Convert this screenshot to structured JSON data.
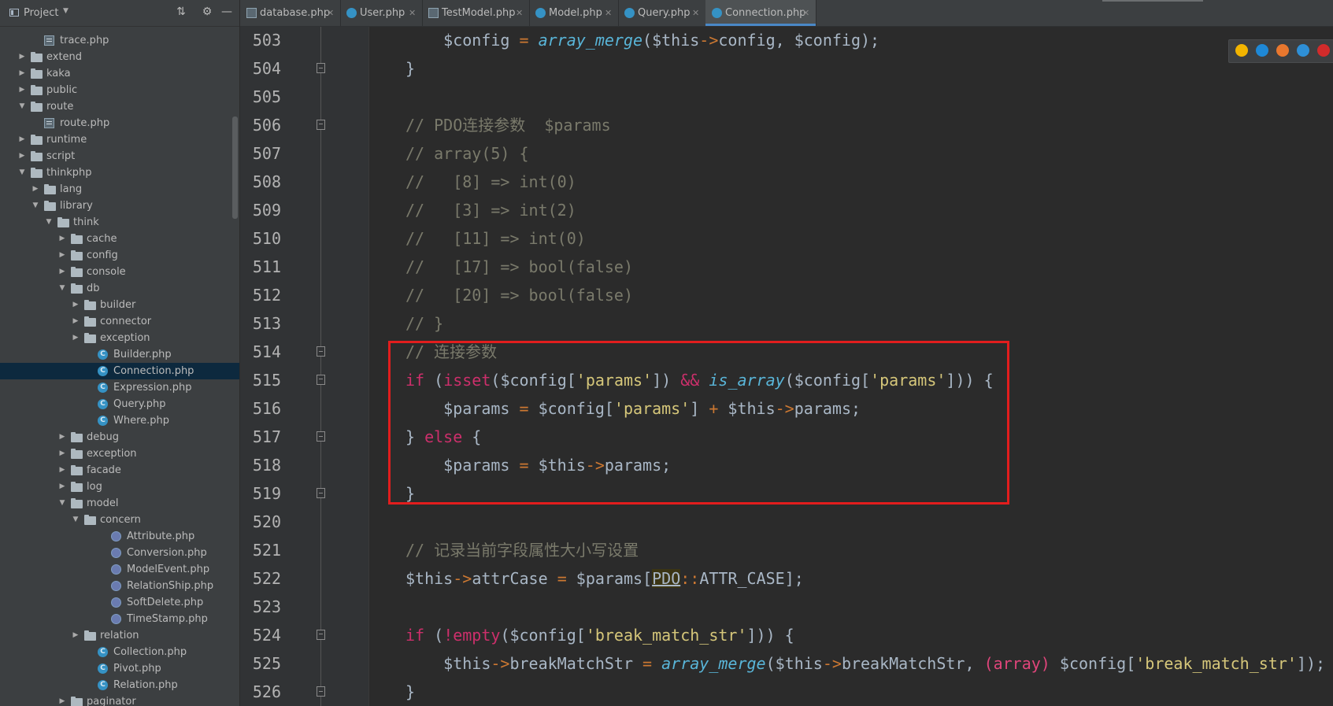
{
  "sidebar": {
    "title": "Project",
    "items": [
      {
        "label": "trace.php",
        "kind": "php",
        "depth": 2,
        "arrow": ""
      },
      {
        "label": "extend",
        "kind": "folder",
        "depth": 1,
        "arrow": "▶"
      },
      {
        "label": "kaka",
        "kind": "folder",
        "depth": 1,
        "arrow": "▶"
      },
      {
        "label": "public",
        "kind": "folder",
        "depth": 1,
        "arrow": "▶"
      },
      {
        "label": "route",
        "kind": "folder",
        "depth": 1,
        "arrow": "▼"
      },
      {
        "label": "route.php",
        "kind": "php",
        "depth": 2,
        "arrow": ""
      },
      {
        "label": "runtime",
        "kind": "folder",
        "depth": 1,
        "arrow": "▶"
      },
      {
        "label": "script",
        "kind": "folder",
        "depth": 1,
        "arrow": "▶"
      },
      {
        "label": "thinkphp",
        "kind": "folder",
        "depth": 1,
        "arrow": "▼"
      },
      {
        "label": "lang",
        "kind": "folder",
        "depth": 2,
        "arrow": "▶"
      },
      {
        "label": "library",
        "kind": "folder",
        "depth": 2,
        "arrow": "▼"
      },
      {
        "label": "think",
        "kind": "folder",
        "depth": 3,
        "arrow": "▼"
      },
      {
        "label": "cache",
        "kind": "folder",
        "depth": 4,
        "arrow": "▶"
      },
      {
        "label": "config",
        "kind": "folder",
        "depth": 4,
        "arrow": "▶"
      },
      {
        "label": "console",
        "kind": "folder",
        "depth": 4,
        "arrow": "▶"
      },
      {
        "label": "db",
        "kind": "folder",
        "depth": 4,
        "arrow": "▼"
      },
      {
        "label": "builder",
        "kind": "folder",
        "depth": 5,
        "arrow": "▶"
      },
      {
        "label": "connector",
        "kind": "folder",
        "depth": 5,
        "arrow": "▶"
      },
      {
        "label": "exception",
        "kind": "folder",
        "depth": 5,
        "arrow": "▶"
      },
      {
        "label": "Builder.php",
        "kind": "abstract",
        "depth": 6,
        "arrow": ""
      },
      {
        "label": "Connection.php",
        "kind": "abstract",
        "depth": 6,
        "arrow": "",
        "selected": true
      },
      {
        "label": "Expression.php",
        "kind": "class",
        "depth": 6,
        "arrow": ""
      },
      {
        "label": "Query.php",
        "kind": "class",
        "depth": 6,
        "arrow": ""
      },
      {
        "label": "Where.php",
        "kind": "class",
        "depth": 6,
        "arrow": ""
      },
      {
        "label": "debug",
        "kind": "folder",
        "depth": 4,
        "arrow": "▶"
      },
      {
        "label": "exception",
        "kind": "folder",
        "depth": 4,
        "arrow": "▶"
      },
      {
        "label": "facade",
        "kind": "folder",
        "depth": 4,
        "arrow": "▶"
      },
      {
        "label": "log",
        "kind": "folder",
        "depth": 4,
        "arrow": "▶"
      },
      {
        "label": "model",
        "kind": "folder",
        "depth": 4,
        "arrow": "▼"
      },
      {
        "label": "concern",
        "kind": "folder",
        "depth": 5,
        "arrow": "▼"
      },
      {
        "label": "Attribute.php",
        "kind": "trait",
        "depth": 7,
        "arrow": ""
      },
      {
        "label": "Conversion.php",
        "kind": "trait",
        "depth": 7,
        "arrow": ""
      },
      {
        "label": "ModelEvent.php",
        "kind": "trait",
        "depth": 7,
        "arrow": ""
      },
      {
        "label": "RelationShip.php",
        "kind": "trait",
        "depth": 7,
        "arrow": ""
      },
      {
        "label": "SoftDelete.php",
        "kind": "trait",
        "depth": 7,
        "arrow": ""
      },
      {
        "label": "TimeStamp.php",
        "kind": "trait",
        "depth": 7,
        "arrow": ""
      },
      {
        "label": "relation",
        "kind": "folder",
        "depth": 5,
        "arrow": "▶"
      },
      {
        "label": "Collection.php",
        "kind": "class",
        "depth": 6,
        "arrow": ""
      },
      {
        "label": "Pivot.php",
        "kind": "class",
        "depth": 6,
        "arrow": ""
      },
      {
        "label": "Relation.php",
        "kind": "abstract",
        "depth": 6,
        "arrow": ""
      },
      {
        "label": "paginator",
        "kind": "folder",
        "depth": 4,
        "arrow": "▶"
      }
    ]
  },
  "tabs": [
    {
      "label": "database.php",
      "icon": "php-file-icon",
      "active": false
    },
    {
      "label": "User.php",
      "icon": "class-icon",
      "active": false
    },
    {
      "label": "TestModel.php",
      "icon": "php-file-icon",
      "active": false
    },
    {
      "label": "Model.php",
      "icon": "abstract-class-icon",
      "active": false
    },
    {
      "label": "Query.php",
      "icon": "class-icon",
      "active": false
    },
    {
      "label": "Connection.php",
      "icon": "abstract-class-icon",
      "active": true
    }
  ],
  "editor": {
    "lines": [
      {
        "no": "503",
        "fold": "",
        "tokens": [
          [
            "    ",
            "plain"
          ],
          [
            "$config",
            "var"
          ],
          [
            " = ",
            "op"
          ],
          [
            "array_merge",
            "fn"
          ],
          [
            "($this",
            "var"
          ],
          [
            "->",
            "arrow"
          ],
          [
            "config, $config);",
            "plain"
          ]
        ]
      },
      {
        "no": "504",
        "fold": "close",
        "tokens": [
          [
            "}",
            "plain"
          ]
        ]
      },
      {
        "no": "505",
        "fold": "",
        "tokens": []
      },
      {
        "no": "506",
        "fold": "open",
        "tokens": [
          [
            "// PDO连接参数  $params",
            "cmt"
          ]
        ]
      },
      {
        "no": "507",
        "fold": "",
        "tokens": [
          [
            "// array(5) {",
            "cmt"
          ]
        ]
      },
      {
        "no": "508",
        "fold": "",
        "tokens": [
          [
            "//   [8] => int(0)",
            "cmt"
          ]
        ]
      },
      {
        "no": "509",
        "fold": "",
        "tokens": [
          [
            "//   [3] => int(2)",
            "cmt"
          ]
        ]
      },
      {
        "no": "510",
        "fold": "",
        "tokens": [
          [
            "//   [11] => int(0)",
            "cmt"
          ]
        ]
      },
      {
        "no": "511",
        "fold": "",
        "tokens": [
          [
            "//   [17] => bool(false)",
            "cmt"
          ]
        ]
      },
      {
        "no": "512",
        "fold": "",
        "tokens": [
          [
            "//   [20] => bool(false)",
            "cmt"
          ]
        ]
      },
      {
        "no": "513",
        "fold": "",
        "tokens": [
          [
            "// }",
            "cmt"
          ]
        ]
      },
      {
        "no": "514",
        "fold": "close",
        "tokens": [
          [
            "// 连接参数",
            "cmt"
          ]
        ]
      },
      {
        "no": "515",
        "fold": "open",
        "tokens": [
          [
            "if",
            "kw"
          ],
          [
            " (",
            "plain"
          ],
          [
            "isset",
            "kw"
          ],
          [
            "($config[",
            "plain"
          ],
          [
            "'params'",
            "str"
          ],
          [
            "]) ",
            "plain"
          ],
          [
            "&&",
            "kw"
          ],
          [
            " ",
            "plain"
          ],
          [
            "is_array",
            "fn"
          ],
          [
            "($config[",
            "plain"
          ],
          [
            "'params'",
            "str"
          ],
          [
            "])) {",
            "plain"
          ]
        ]
      },
      {
        "no": "516",
        "fold": "",
        "tokens": [
          [
            "    $params ",
            "plain"
          ],
          [
            "=",
            "op"
          ],
          [
            " $config[",
            "plain"
          ],
          [
            "'params'",
            "str"
          ],
          [
            "] ",
            "plain"
          ],
          [
            "+",
            "op"
          ],
          [
            " $this",
            "plain"
          ],
          [
            "->",
            "arrow"
          ],
          [
            "params;",
            "plain"
          ]
        ]
      },
      {
        "no": "517",
        "fold": "close",
        "tokens": [
          [
            "} ",
            "plain"
          ],
          [
            "else",
            "kw"
          ],
          [
            " {",
            "plain"
          ]
        ]
      },
      {
        "no": "518",
        "fold": "",
        "tokens": [
          [
            "    $params ",
            "plain"
          ],
          [
            "=",
            "op"
          ],
          [
            " $this",
            "plain"
          ],
          [
            "->",
            "arrow"
          ],
          [
            "params;",
            "plain"
          ]
        ]
      },
      {
        "no": "519",
        "fold": "close",
        "tokens": [
          [
            "}",
            "plain"
          ]
        ]
      },
      {
        "no": "520",
        "fold": "",
        "tokens": []
      },
      {
        "no": "521",
        "fold": "",
        "tokens": [
          [
            "// 记录当前字段属性大小写设置",
            "cmt"
          ]
        ]
      },
      {
        "no": "522",
        "fold": "",
        "tokens": [
          [
            "$this",
            "plain"
          ],
          [
            "->",
            "arrow"
          ],
          [
            "attrCase ",
            "plain"
          ],
          [
            "=",
            "op"
          ],
          [
            " $params[",
            "plain"
          ],
          [
            "PDO",
            "cls"
          ],
          [
            "::",
            "arrow"
          ],
          [
            "ATTR_CASE];",
            "plain"
          ]
        ]
      },
      {
        "no": "523",
        "fold": "",
        "tokens": []
      },
      {
        "no": "524",
        "fold": "open",
        "tokens": [
          [
            "if",
            "kw"
          ],
          [
            " (",
            "plain"
          ],
          [
            "!empty",
            "kw"
          ],
          [
            "($config[",
            "plain"
          ],
          [
            "'break_match_str'",
            "str"
          ],
          [
            "])) {",
            "plain"
          ]
        ]
      },
      {
        "no": "525",
        "fold": "",
        "tokens": [
          [
            "    $this",
            "plain"
          ],
          [
            "->",
            "arrow"
          ],
          [
            "breakMatchStr ",
            "plain"
          ],
          [
            "=",
            "op"
          ],
          [
            " ",
            "plain"
          ],
          [
            "array_merge",
            "fn"
          ],
          [
            "($this",
            "plain"
          ],
          [
            "->",
            "arrow"
          ],
          [
            "breakMatchStr, ",
            "plain"
          ],
          [
            "(array)",
            "pink"
          ],
          [
            " $config[",
            "plain"
          ],
          [
            "'break_match_str'",
            "str"
          ],
          [
            "]);",
            "plain"
          ]
        ]
      },
      {
        "no": "526",
        "fold": "close",
        "tokens": [
          [
            "}",
            "plain"
          ]
        ]
      }
    ]
  },
  "browser_icons": [
    "chrome-icon",
    "edge-icon",
    "firefox-icon",
    "safari-icon",
    "opera-icon"
  ],
  "colors": {
    "highlight_box": "#e21d1d",
    "tab_active_underline": "#4a88c7",
    "selected_row": "#0d293e"
  }
}
